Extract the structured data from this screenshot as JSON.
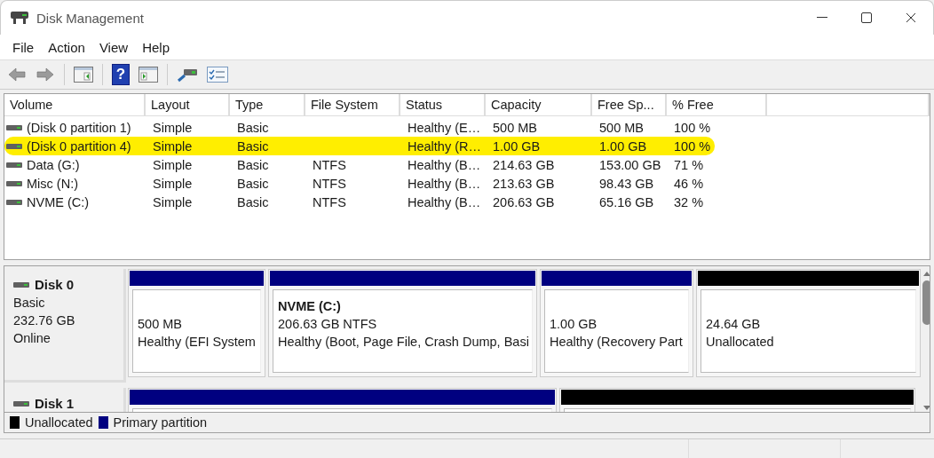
{
  "window": {
    "title": "Disk Management"
  },
  "menu": [
    "File",
    "Action",
    "View",
    "Help"
  ],
  "toolbar": [
    {
      "kind": "back",
      "disabled": true
    },
    {
      "kind": "forward",
      "disabled": true
    },
    {
      "kind": "sep"
    },
    {
      "kind": "panel-left"
    },
    {
      "kind": "sep"
    },
    {
      "kind": "help",
      "glyph": "?"
    },
    {
      "kind": "panel-right"
    },
    {
      "kind": "sep"
    },
    {
      "kind": "connect"
    },
    {
      "kind": "checklist"
    }
  ],
  "table": {
    "columns": [
      "Volume",
      "Layout",
      "Type",
      "File System",
      "Status",
      "Capacity",
      "Free Sp...",
      "% Free"
    ],
    "rows": [
      {
        "cells": [
          "(Disk 0 partition 1)",
          "Simple",
          "Basic",
          "",
          "Healthy (E…",
          "500 MB",
          "500 MB",
          "100 %"
        ],
        "marked": false
      },
      {
        "cells": [
          "(Disk 0 partition 4)",
          "Simple",
          "Basic",
          "",
          "Healthy (R…",
          "1.00 GB",
          "1.00 GB",
          "100 %"
        ],
        "marked": true
      },
      {
        "cells": [
          "Data (G:)",
          "Simple",
          "Basic",
          "NTFS",
          "Healthy (B…",
          "214.63 GB",
          "153.00 GB",
          "71 %"
        ],
        "marked": false
      },
      {
        "cells": [
          "Misc (N:)",
          "Simple",
          "Basic",
          "NTFS",
          "Healthy (B…",
          "213.63 GB",
          "98.43 GB",
          "46 %"
        ],
        "marked": false
      },
      {
        "cells": [
          "NVME (C:)",
          "Simple",
          "Basic",
          "NTFS",
          "Healthy (B…",
          "206.63 GB",
          "65.16 GB",
          "32 %"
        ],
        "marked": false
      }
    ]
  },
  "disks": [
    {
      "name": "Disk 0",
      "type": "Basic",
      "size": "232.76 GB",
      "status": "Online",
      "partitions": [
        {
          "kind": "primary",
          "size": "500 MB",
          "status": "Healthy (EFI System"
        },
        {
          "kind": "primary",
          "name": "NVME  (C:)",
          "size": "206.63 GB NTFS",
          "status": "Healthy (Boot, Page File, Crash Dump, Basi"
        },
        {
          "kind": "primary",
          "size": "1.00 GB",
          "status": "Healthy (Recovery Part"
        },
        {
          "kind": "unallocated",
          "size": "24.64 GB",
          "status": "Unallocated"
        }
      ]
    },
    {
      "name": "Disk 1",
      "partitions": [
        {
          "kind": "primary"
        },
        {
          "kind": "unallocated"
        }
      ]
    }
  ],
  "legend": [
    {
      "kind": "unallocated",
      "label": "Unallocated"
    },
    {
      "kind": "primary",
      "label": "Primary partition"
    }
  ]
}
